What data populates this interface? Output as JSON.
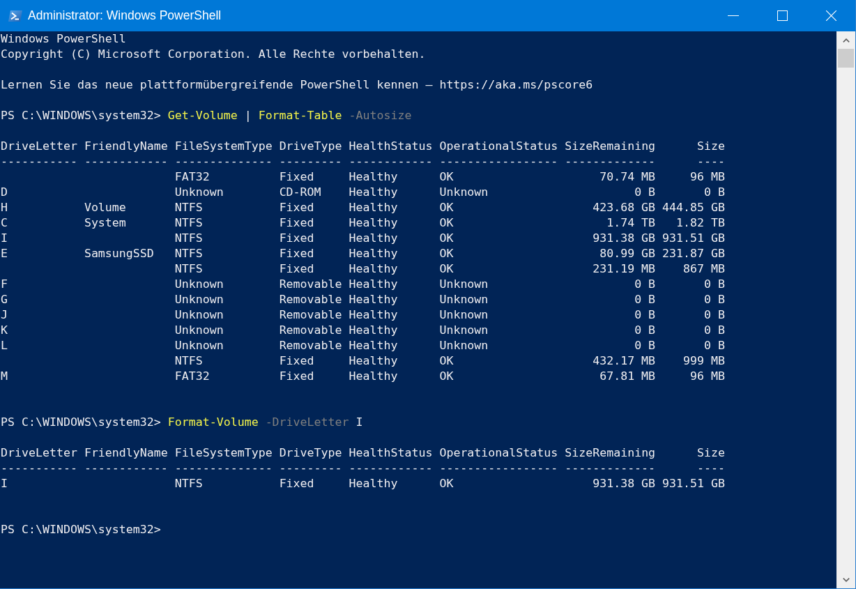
{
  "window": {
    "title": "Administrator: Windows PowerShell"
  },
  "console": {
    "blocks": [
      {
        "kind": "text",
        "text": "Windows PowerShell"
      },
      {
        "kind": "text",
        "text": "Copyright (C) Microsoft Corporation. Alle Rechte vorbehalten."
      },
      {
        "kind": "blank"
      },
      {
        "kind": "text",
        "text": "Lernen Sie das neue plattformübergreifende PowerShell kennen – https://aka.ms/pscore6"
      },
      {
        "kind": "blank"
      },
      {
        "kind": "prompt",
        "prompt": "PS C:\\WINDOWS\\system32>",
        "tokens": [
          {
            "kind": "command",
            "text": "Get-Volume"
          },
          {
            "kind": "operator",
            "text": "|"
          },
          {
            "kind": "command",
            "text": "Format-Table"
          },
          {
            "kind": "parameter",
            "text": "-Autosize"
          }
        ]
      },
      {
        "kind": "blank"
      },
      {
        "kind": "table",
        "columns": [
          {
            "header": "DriveLetter",
            "kind": "text"
          },
          {
            "header": "FriendlyName",
            "kind": "text"
          },
          {
            "header": "FileSystemType",
            "kind": "text"
          },
          {
            "header": "DriveType",
            "kind": "text"
          },
          {
            "header": "HealthStatus",
            "kind": "text"
          },
          {
            "header": "OperationalStatus",
            "kind": "text"
          },
          {
            "header": "SizeRemaining",
            "kind": "number"
          },
          {
            "header": "Size",
            "kind": "number"
          }
        ],
        "rule": "----------- ------------ -------------- --------- ------------ ----------------- -------------      ----",
        "rows": [
          [
            null,
            null,
            "FAT32",
            "Fixed",
            "Healthy",
            "OK",
            "70.74 MB",
            "96 MB"
          ],
          [
            "D",
            null,
            "Unknown",
            "CD-ROM",
            "Healthy",
            "Unknown",
            "0 B",
            "0 B"
          ],
          [
            "H",
            "Volume",
            "NTFS",
            "Fixed",
            "Healthy",
            "OK",
            "423.68 GB",
            "444.85 GB"
          ],
          [
            "C",
            "System",
            "NTFS",
            "Fixed",
            "Healthy",
            "OK",
            "1.74 TB",
            "1.82 TB"
          ],
          [
            "I",
            null,
            "NTFS",
            "Fixed",
            "Healthy",
            "OK",
            "931.38 GB",
            "931.51 GB"
          ],
          [
            "E",
            "SamsungSSD",
            "NTFS",
            "Fixed",
            "Healthy",
            "OK",
            "80.99 GB",
            "231.87 GB"
          ],
          [
            null,
            null,
            "NTFS",
            "Fixed",
            "Healthy",
            "OK",
            "231.19 MB",
            "867 MB"
          ],
          [
            "F",
            null,
            "Unknown",
            "Removable",
            "Healthy",
            "Unknown",
            "0 B",
            "0 B"
          ],
          [
            "G",
            null,
            "Unknown",
            "Removable",
            "Healthy",
            "Unknown",
            "0 B",
            "0 B"
          ],
          [
            "J",
            null,
            "Unknown",
            "Removable",
            "Healthy",
            "Unknown",
            "0 B",
            "0 B"
          ],
          [
            "K",
            null,
            "Unknown",
            "Removable",
            "Healthy",
            "Unknown",
            "0 B",
            "0 B"
          ],
          [
            "L",
            null,
            "Unknown",
            "Removable",
            "Healthy",
            "Unknown",
            "0 B",
            "0 B"
          ],
          [
            null,
            null,
            "NTFS",
            "Fixed",
            "Healthy",
            "OK",
            "432.17 MB",
            "999 MB"
          ],
          [
            "M",
            null,
            "FAT32",
            "Fixed",
            "Healthy",
            "OK",
            "67.81 MB",
            "96 MB"
          ]
        ]
      },
      {
        "kind": "blank"
      },
      {
        "kind": "blank"
      },
      {
        "kind": "prompt",
        "prompt": "PS C:\\WINDOWS\\system32>",
        "tokens": [
          {
            "kind": "command",
            "text": "Format-Volume"
          },
          {
            "kind": "parameter",
            "text": "-DriveLetter"
          },
          {
            "kind": "argument",
            "text": "I"
          }
        ]
      },
      {
        "kind": "blank"
      },
      {
        "kind": "table",
        "columns": [
          {
            "header": "DriveLetter",
            "kind": "text"
          },
          {
            "header": "FriendlyName",
            "kind": "text"
          },
          {
            "header": "FileSystemType",
            "kind": "text"
          },
          {
            "header": "DriveType",
            "kind": "text"
          },
          {
            "header": "HealthStatus",
            "kind": "text"
          },
          {
            "header": "OperationalStatus",
            "kind": "text"
          },
          {
            "header": "SizeRemaining",
            "kind": "number"
          },
          {
            "header": "Size",
            "kind": "number"
          }
        ],
        "rule": "----------- ------------ -------------- --------- ------------ ----------------- -------------      ----",
        "rows": [
          [
            "I",
            null,
            "NTFS",
            "Fixed",
            "Healthy",
            "OK",
            "931.38 GB",
            "931.51 GB"
          ]
        ]
      },
      {
        "kind": "blank"
      },
      {
        "kind": "blank"
      },
      {
        "kind": "prompt",
        "prompt": "PS C:\\WINDOWS\\system32>"
      }
    ]
  }
}
